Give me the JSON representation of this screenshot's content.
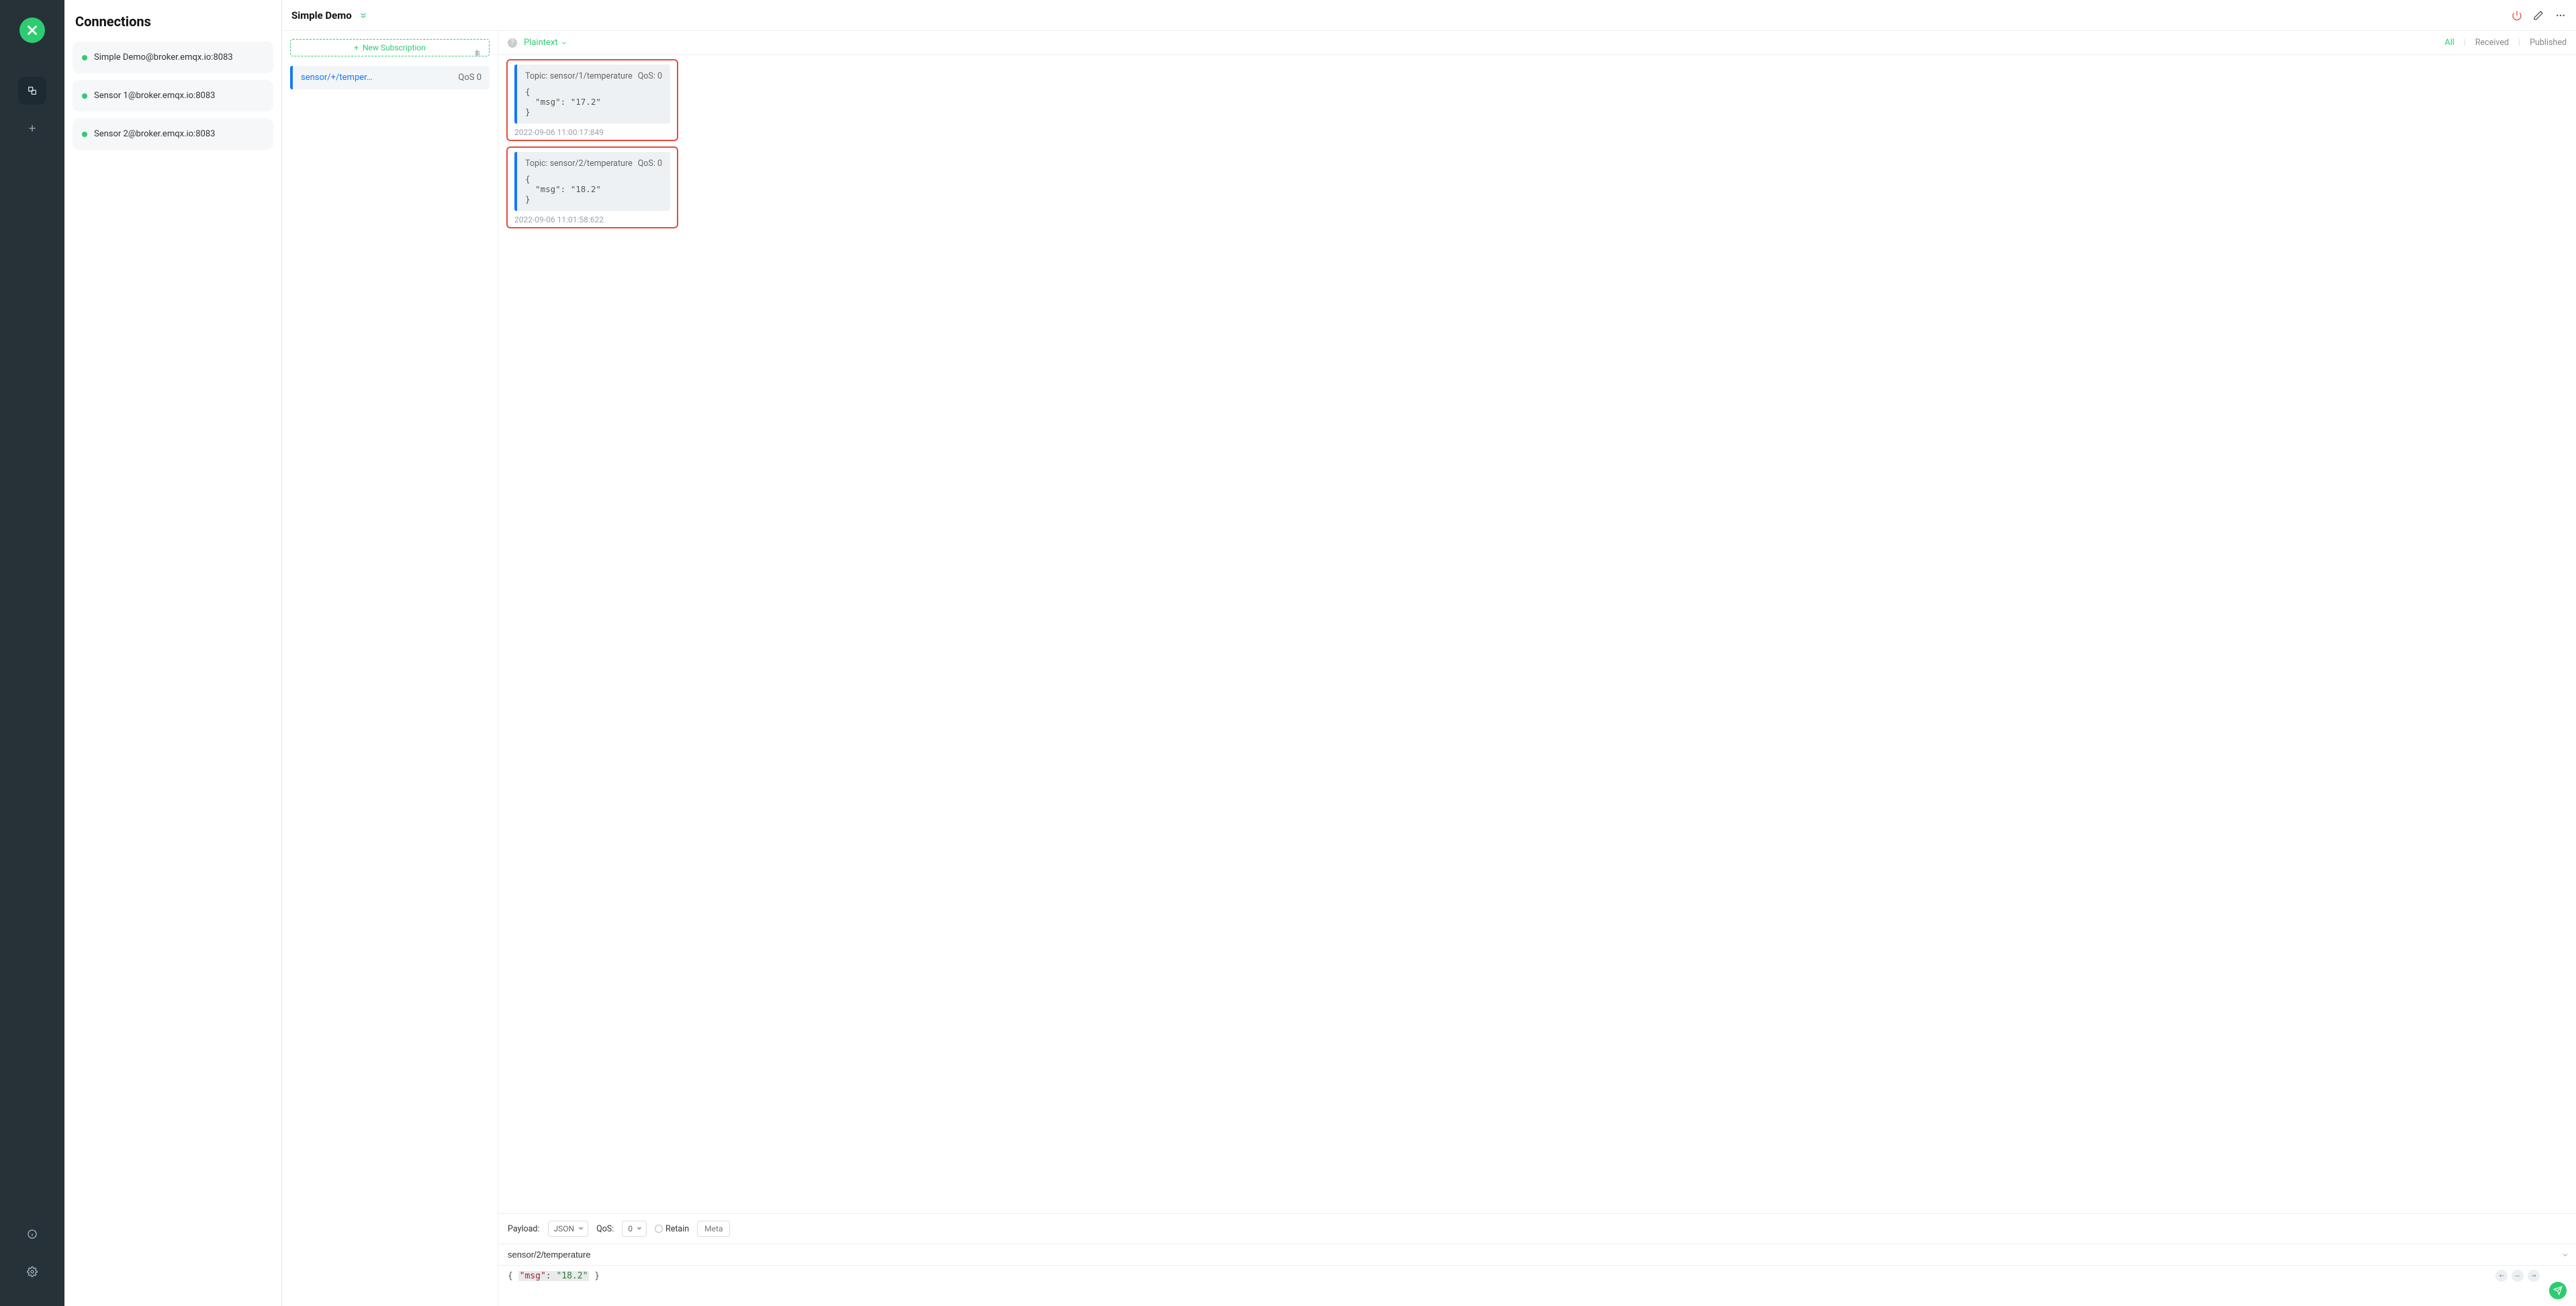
{
  "brand": {
    "accent": "#2ecc71",
    "primary": "#1677ff",
    "danger": "#e74c3c"
  },
  "sidebar": {
    "title": "Connections",
    "items": [
      {
        "label": "Simple Demo@broker.emqx.io:8083",
        "online": true
      },
      {
        "label": "Sensor 1@broker.emqx.io:8083",
        "online": true
      },
      {
        "label": "Sensor 2@broker.emqx.io:8083",
        "online": true
      }
    ]
  },
  "topbar": {
    "title": "Simple Demo"
  },
  "subs": {
    "new_label": "New Subscription",
    "items": [
      {
        "name": "sensor/+/temper…",
        "qos": "QoS 0"
      }
    ]
  },
  "feed": {
    "format": "Plaintext",
    "filters": {
      "all": "All",
      "received": "Received",
      "published": "Published",
      "active": "all"
    },
    "messages": [
      {
        "topic_label": "Topic: sensor/1/temperature",
        "qos_label": "QoS: 0",
        "body": "{\n  \"msg\": \"17.2\"\n}",
        "ts": "2022-09-06 11:00:17:849",
        "highlighted": true
      },
      {
        "topic_label": "Topic: sensor/2/temperature",
        "qos_label": "QoS: 0",
        "body": "{\n  \"msg\": \"18.2\"\n}",
        "ts": "2022-09-06 11:01:58:622",
        "highlighted": true
      }
    ]
  },
  "editor": {
    "payload_label": "Payload:",
    "payload_fmt": "JSON",
    "qos_label": "QoS:",
    "qos_value": "0",
    "retain_label": "Retain",
    "meta_label": "Meta",
    "topic": "sensor/2/temperature",
    "body_key": "\"msg\"",
    "body_val": "\"18.2\""
  }
}
